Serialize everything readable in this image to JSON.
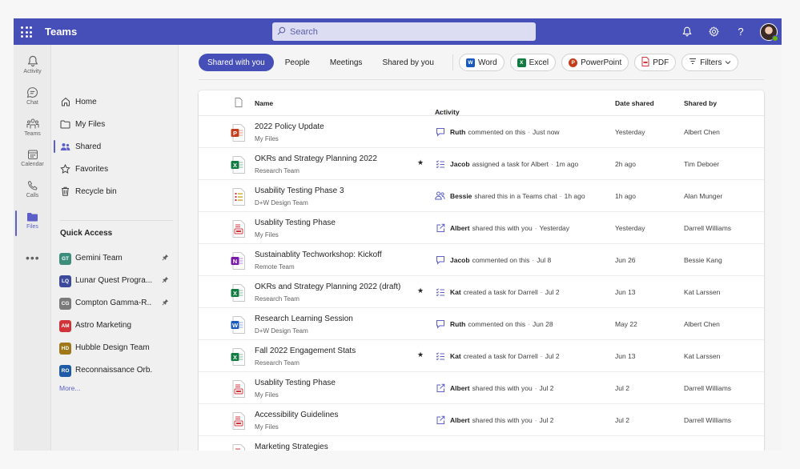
{
  "topbar": {
    "app_title": "Teams",
    "search_placeholder": "Search"
  },
  "rail": [
    {
      "label": "Activity",
      "icon": "bell-icon"
    },
    {
      "label": "Chat",
      "icon": "chat-icon"
    },
    {
      "label": "Teams",
      "icon": "teams-icon"
    },
    {
      "label": "Calendar",
      "icon": "calendar-icon"
    },
    {
      "label": "Calls",
      "icon": "phone-icon"
    },
    {
      "label": "Files",
      "icon": "folder-icon"
    }
  ],
  "sidenav": {
    "items": [
      {
        "label": "Home",
        "icon": "home-icon"
      },
      {
        "label": "My Files",
        "icon": "folder-icon"
      },
      {
        "label": "Shared",
        "icon": "people-icon"
      },
      {
        "label": "Favorites",
        "icon": "star-icon"
      },
      {
        "label": "Recycle bin",
        "icon": "trash-icon"
      }
    ],
    "quick_access_title": "Quick Access",
    "quick_access": [
      {
        "initials": "GT",
        "label": "Gemini Team",
        "color": "#3c8d7c",
        "pinned": true
      },
      {
        "initials": "LQ",
        "label": "Lunar Quest Progra...",
        "color": "#3d4a9b",
        "pinned": true
      },
      {
        "initials": "CG",
        "label": "Compton Gamma-R...",
        "color": "#7a7a7a",
        "pinned": true
      },
      {
        "initials": "AM",
        "label": "Astro Marketing",
        "color": "#d13438",
        "pinned": false
      },
      {
        "initials": "HD",
        "label": "Hubble Design Team",
        "color": "#a0781a",
        "pinned": false
      },
      {
        "initials": "RO",
        "label": "Reconnaissance Orb...",
        "color": "#1f5aa6",
        "pinned": false
      }
    ],
    "more_label": "More..."
  },
  "tabs": [
    "Shared with you",
    "People",
    "Meetings",
    "Shared by you"
  ],
  "filter_chips": [
    {
      "label": "Word",
      "icon": "word-icon",
      "color": "#185abd",
      "letter": "W"
    },
    {
      "label": "Excel",
      "icon": "excel-icon",
      "color": "#107c41",
      "letter": "X"
    },
    {
      "label": "PowerPoint",
      "icon": "powerpoint-icon",
      "color": "#c43e1c",
      "letter": "P"
    },
    {
      "label": "PDF",
      "icon": "pdf-icon",
      "color": "#d13438",
      "letter": ""
    }
  ],
  "filters_label": "Filters",
  "table": {
    "columns": {
      "name": "Name",
      "activity": "Activity",
      "date": "Date shared",
      "by": "Shared by"
    },
    "rows": [
      {
        "name": "2022 Policy Update",
        "location": "My Files",
        "type": "powerpoint",
        "starred": false,
        "activity_icon": "comment-icon",
        "activity_user": "Ruth",
        "activity_text": "commented on this",
        "activity_time": "Just now",
        "date": "Yesterday",
        "by": "Albert Chen"
      },
      {
        "name": "OKRs and Strategy Planning 2022",
        "location": "Research Team",
        "type": "excel",
        "starred": true,
        "activity_icon": "task-icon",
        "activity_user": "Jacob",
        "activity_text": "assigned a task for Albert",
        "activity_time": "1m ago",
        "date": "2h ago",
        "by": "Tim Deboer"
      },
      {
        "name": "Usability Testing Phase 3",
        "location": "D+W Design Team",
        "type": "list",
        "starred": false,
        "activity_icon": "people-icon",
        "activity_user": "Bessie",
        "activity_text": "shared this in a Teams chat",
        "activity_time": "1h ago",
        "date": "1h ago",
        "by": "Alan Munger"
      },
      {
        "name": "Usablity Testing Phase",
        "location": "My Files",
        "type": "pdf",
        "starred": false,
        "activity_icon": "share-icon",
        "activity_user": "Albert",
        "activity_text": "shared this with you",
        "activity_time": "Yesterday",
        "date": "Yesterday",
        "by": "Darrell Williams"
      },
      {
        "name": "Sustainablity Techworkshop: Kickoff",
        "location": "Remote Team",
        "type": "onenote",
        "starred": false,
        "activity_icon": "comment-icon",
        "activity_user": "Jacob",
        "activity_text": "commented on this",
        "activity_time": "Jul 8",
        "date": "Jun 26",
        "by": "Bessie Kang"
      },
      {
        "name": "OKRs and Strategy Planning 2022 (draft)",
        "location": "Research Team",
        "type": "excel",
        "starred": true,
        "activity_icon": "task-icon",
        "activity_user": "Kat",
        "activity_text": "created a task for Darrell",
        "activity_time": "Jul 2",
        "date": "Jun 13",
        "by": "Kat Larssen"
      },
      {
        "name": "Research Learning Session",
        "location": "D+W Design Team",
        "type": "word",
        "starred": false,
        "activity_icon": "comment-icon",
        "activity_user": "Ruth",
        "activity_text": "commented on this",
        "activity_time": "Jun 28",
        "date": "May 22",
        "by": "Albert Chen"
      },
      {
        "name": "Fall 2022 Engagement Stats",
        "location": "Research Team",
        "type": "excel",
        "starred": true,
        "activity_icon": "task-icon",
        "activity_user": "Kat",
        "activity_text": "created a task for Darrell",
        "activity_time": "Jul 2",
        "date": "Jun 13",
        "by": "Kat Larssen"
      },
      {
        "name": "Usablity Testing Phase",
        "location": "My Files",
        "type": "pdf",
        "starred": false,
        "activity_icon": "share-icon",
        "activity_user": "Albert",
        "activity_text": "shared this with you",
        "activity_time": "Jul 2",
        "date": "Jul 2",
        "by": "Darrell Williams"
      },
      {
        "name": "Accessibility Guidelines",
        "location": "My Files",
        "type": "pdf",
        "starred": false,
        "activity_icon": "share-icon",
        "activity_user": "Albert",
        "activity_text": "shared this with you",
        "activity_time": "Jul 2",
        "date": "Jul 2",
        "by": "Darrell Williams"
      },
      {
        "name": "Marketing Strategies",
        "location": "",
        "type": "pdf",
        "starred": false,
        "activity_icon": "",
        "activity_user": "",
        "activity_text": "",
        "activity_time": "",
        "date": "",
        "by": ""
      }
    ]
  }
}
